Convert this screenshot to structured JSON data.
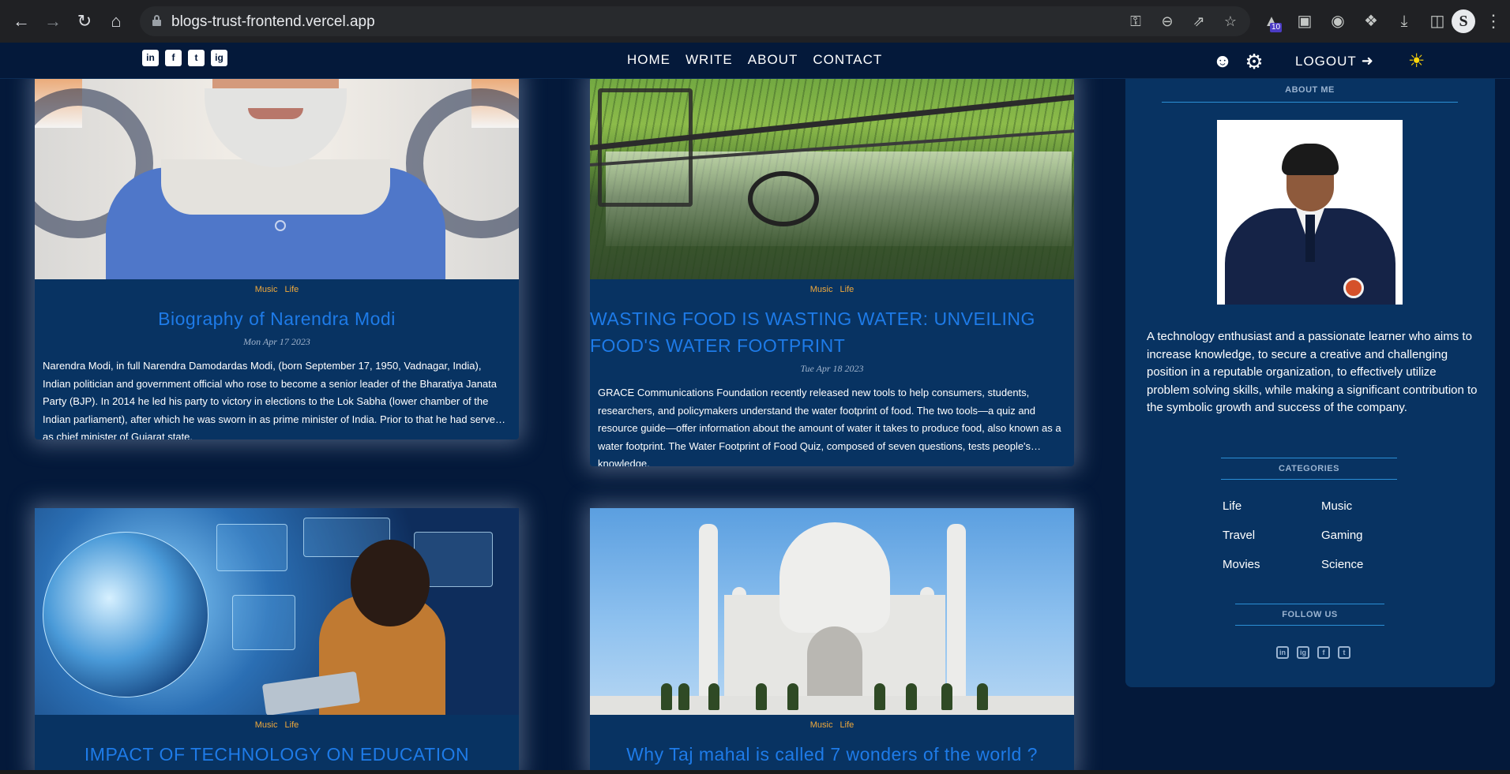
{
  "browser": {
    "url": "blogs-trust-frontend.vercel.app",
    "extension_badge": "10",
    "profile_initial": "S"
  },
  "site": {
    "social_top": [
      "in",
      "f",
      "t",
      "ig"
    ],
    "menu": [
      "HOME",
      "WRITE",
      "ABOUT",
      "CONTACT"
    ],
    "logout_label": "LOGOUT"
  },
  "posts": [
    {
      "categories": "Music Life",
      "title": "Biography of Narendra Modi",
      "date": "Mon Apr 17 2023",
      "excerpt": "Narendra Modi, in full Narendra Damodardas Modi, (born September 17, 1950, Vadnagar, India), Indian politician and government official who rose to become a senior leader of the Bharatiya Janata Party (BJP). In 2014 he led his party to victory in elections to the Lok Sabha (lower chamber of the Indian parliament), after which he was sworn in as prime minister of India. Prior to that he had served as chief minister of Gujarat state."
    },
    {
      "categories": "Music Life",
      "title": "WASTING FOOD IS WASTING WATER: UNVEILING FOOD'S WATER FOOTPRINT",
      "date": "Tue Apr 18 2023",
      "excerpt": "GRACE Communications Foundation recently released new tools to help consumers, students, researchers, and policymakers understand the water footprint of food. The two tools—a quiz and resource guide—offer information about the amount of water it takes to produce food, also known as a water footprint. The Water Footprint of Food Quiz, composed of seven questions, tests people's knowledge."
    },
    {
      "categories": "Music Life",
      "title": "IMPACT OF TECHNOLOGY ON EDUCATION"
    },
    {
      "categories": "Music Life",
      "title": "Why Taj mahal is called 7 wonders of the world ?"
    }
  ],
  "sidebar": {
    "about_title": "ABOUT ME",
    "about_text": "A technology enthusiast and a passionate learner who aims to increase knowledge, to secure a creative and challenging position in a reputable organization, to effectively utilize problem solving skills, while making a significant contribution to the symbolic growth and success of the company.",
    "categories_title": "CATEGORIES",
    "categories": [
      "Life",
      "Music",
      "Travel",
      "Gaming",
      "Movies",
      "Science"
    ],
    "follow_title": "FOLLOW US",
    "follow_icons": [
      "in",
      "ig",
      "f",
      "t"
    ]
  },
  "icons": {
    "back": "arrow-left-icon",
    "forward": "arrow-right-icon",
    "reload": "reload-icon",
    "home": "home-icon",
    "theme": "sun-icon"
  }
}
